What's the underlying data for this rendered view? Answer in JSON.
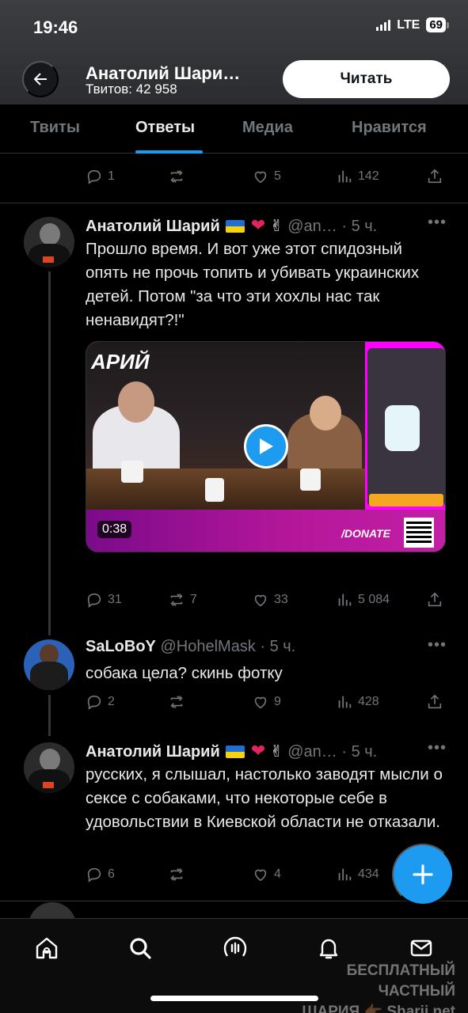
{
  "status": {
    "time": "19:46",
    "network": "LTE",
    "battery": "69"
  },
  "header": {
    "title": "Анатолий Шари…",
    "tweet_count": "Твитов: 42 958",
    "follow_label": "Читать"
  },
  "tabs": [
    {
      "label": "Твиты",
      "active": false
    },
    {
      "label": "Ответы",
      "active": true
    },
    {
      "label": "Медиа",
      "active": false
    },
    {
      "label": "Нравится",
      "active": false
    }
  ],
  "tweets": [
    {
      "replies": "1",
      "retweets": "",
      "likes": "5",
      "views": "142"
    },
    {
      "name": "Анатолий Шарий",
      "handle": "@an…",
      "time": "· 5 ч.",
      "text": "Прошло время. И вот уже этот спидозный опять не прочь топить и убивать украинских детей. Потом \"за что эти хохлы нас так ненавидят?!\"",
      "media": {
        "duration": "0:38",
        "overlay_text": "/DONATE",
        "logo_text": "АРИЙ"
      },
      "replies": "31",
      "retweets": "7",
      "likes": "33",
      "views": "5 084"
    },
    {
      "name": "SaLoBoY",
      "handle": "@HohelMask",
      "time": "· 5 ч.",
      "text": "собака цела? скинь фотку",
      "replies": "2",
      "retweets": "",
      "likes": "9",
      "views": "428"
    },
    {
      "name": "Анатолий Шарий",
      "handle": "@an…",
      "time": "· 5 ч.",
      "text": "русских, я слышал, настолько заводят мысли о сексе с собаками, что некоторые себе в удовольствии в Киевской области не отказали.",
      "replies": "6",
      "retweets": "",
      "likes": "4",
      "views": "434"
    }
  ],
  "watermark": {
    "line1": "БЕСПЛАТНЫЙ ЧАСТНЫЙ",
    "line2": "ШАРИЯ 👉🏾 Sharij.net"
  },
  "colors": {
    "accent": "#1d9bf0",
    "background": "#000000",
    "muted": "#71767b",
    "text": "#e7e9ea"
  },
  "icons": [
    "back-arrow-icon",
    "reply-icon",
    "retweet-icon",
    "like-icon",
    "views-icon",
    "share-icon",
    "play-icon",
    "compose-icon",
    "home-icon",
    "search-icon",
    "spaces-icon",
    "notifications-icon",
    "messages-icon"
  ]
}
